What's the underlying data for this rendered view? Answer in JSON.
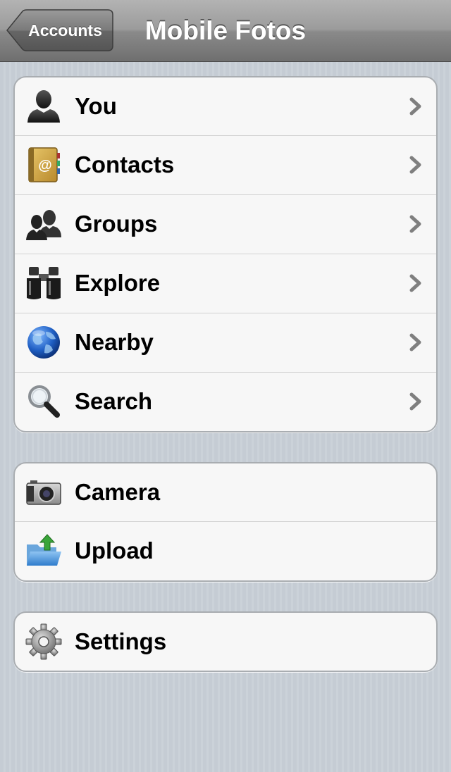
{
  "navbar": {
    "title": "Mobile Fotos",
    "back_label": "Accounts"
  },
  "groups": [
    {
      "items": [
        {
          "label": "You",
          "icon": "person-icon",
          "disclosure": true
        },
        {
          "label": "Contacts",
          "icon": "address-book-icon",
          "disclosure": true
        },
        {
          "label": "Groups",
          "icon": "group-icon",
          "disclosure": true
        },
        {
          "label": "Explore",
          "icon": "binoculars-icon",
          "disclosure": true
        },
        {
          "label": "Nearby",
          "icon": "globe-icon",
          "disclosure": true
        },
        {
          "label": "Search",
          "icon": "magnifier-icon",
          "disclosure": true
        }
      ]
    },
    {
      "items": [
        {
          "label": "Camera",
          "icon": "camera-icon",
          "disclosure": false
        },
        {
          "label": "Upload",
          "icon": "upload-folder-icon",
          "disclosure": false
        }
      ]
    },
    {
      "items": [
        {
          "label": "Settings",
          "icon": "gear-icon",
          "disclosure": false
        }
      ]
    }
  ],
  "colors": {
    "navbar": "#8a8a8a",
    "background": "#c5ccd4",
    "cell": "#f7f7f7",
    "chevron": "#7f7f7f"
  }
}
